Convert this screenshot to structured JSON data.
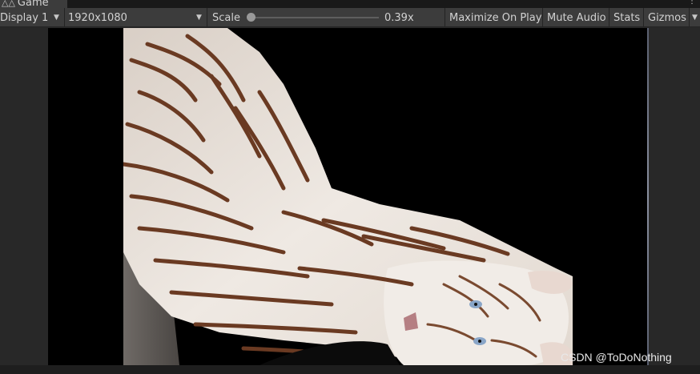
{
  "tab": {
    "icon": "gamepad-icon",
    "label": "Game",
    "menu": "more-icon"
  },
  "toolbar": {
    "display_label": "Display 1",
    "resolution_label": "1920x1080",
    "scale_label": "Scale",
    "scale_value": "0.39x",
    "scale_fraction": 0.0,
    "maximize_label": "Maximize On Play",
    "mute_label": "Mute Audio",
    "stats_label": "Stats",
    "gizmos_label": "Gizmos"
  },
  "game_view": {
    "content": "white-tiger-image",
    "watermark": "CSDN @ToDoNothing"
  },
  "colors": {
    "toolbar_bg": "#3c3c3c",
    "canvas_bg": "#000000",
    "panel_bg": "#282828",
    "tiger_white": "#ede7e1",
    "tiger_stripe": "#6a3a22"
  }
}
